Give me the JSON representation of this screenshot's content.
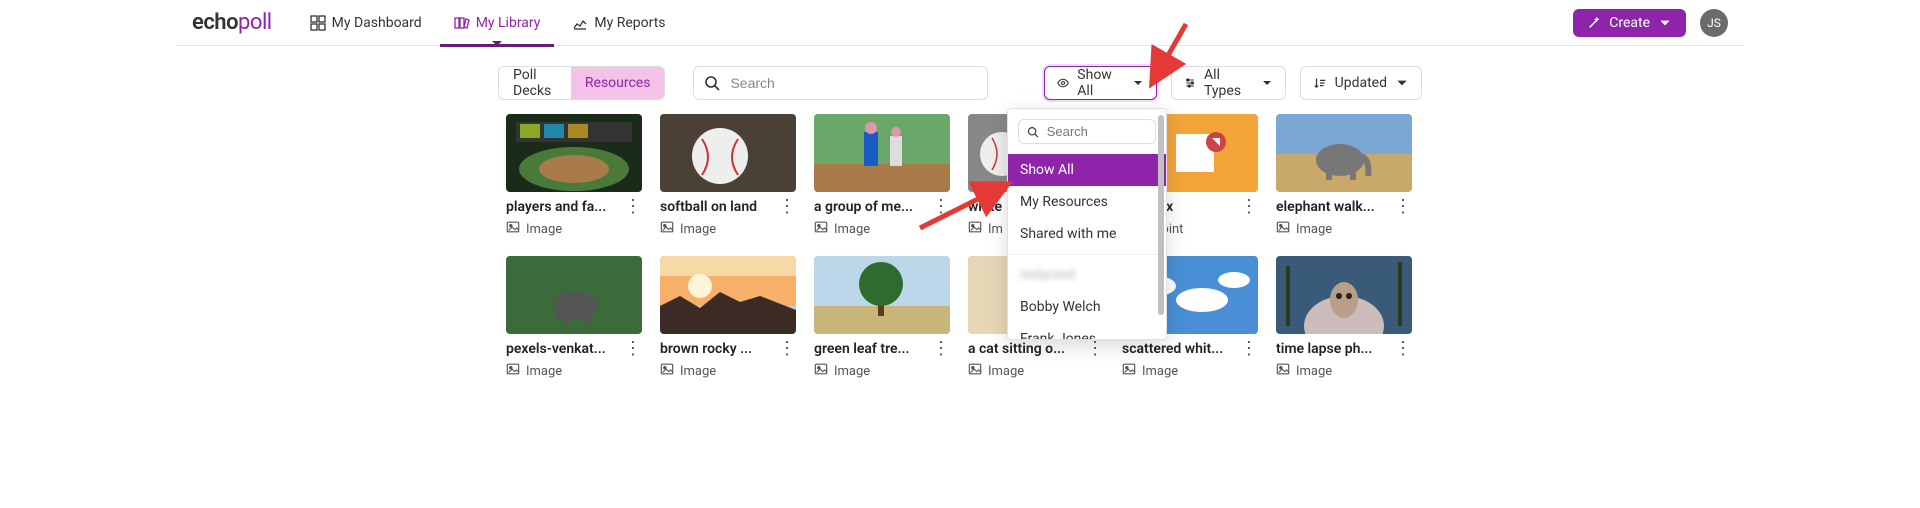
{
  "brand": {
    "part1": "echo",
    "part2": "poll"
  },
  "nav": {
    "items": [
      {
        "label": "My Dashboard"
      },
      {
        "label": "My Library"
      },
      {
        "label": "My Reports"
      }
    ]
  },
  "header": {
    "create_label": "Create",
    "avatar_initials": "JS"
  },
  "toolbar": {
    "segmented": {
      "poll_decks": "Poll Decks",
      "resources": "Resources"
    },
    "search_placeholder": "Search",
    "filter_visibility": {
      "label": "Show All"
    },
    "filter_type": {
      "label": "All Types"
    },
    "filter_sort": {
      "label": "Updated"
    }
  },
  "dropdown": {
    "search_placeholder": "Search",
    "items": [
      {
        "label": "Show All",
        "selected": true
      },
      {
        "label": "My Resources"
      },
      {
        "label": "Shared with me"
      },
      {
        "label": "redacted",
        "blurred": true
      },
      {
        "label": "Bobby Welch"
      },
      {
        "label": "Frank Jones",
        "truncated": true
      }
    ]
  },
  "cards": [
    {
      "title": "players and fa...",
      "type": "Image",
      "thumb": "stadium"
    },
    {
      "title": "softball on land",
      "type": "Image",
      "thumb": "baseball"
    },
    {
      "title": "a group of me...",
      "type": "Image",
      "thumb": "baseball-players"
    },
    {
      "title": "white",
      "type": "Im",
      "thumb": "baseballs"
    },
    {
      "title": "nts.pptx",
      "type": "erPoint",
      "thumb": "ppt"
    },
    {
      "title": "elephant walk...",
      "type": "Image",
      "thumb": "elephant-savanna"
    },
    {
      "title": "pexels-venkat...",
      "type": "Image",
      "thumb": "elephant-forest"
    },
    {
      "title": "brown rocky ...",
      "type": "Image",
      "thumb": "sunset-rocks"
    },
    {
      "title": "green leaf tre...",
      "type": "Image",
      "thumb": "tree"
    },
    {
      "title": "a cat sitting o...",
      "type": "Image",
      "thumb": "cat"
    },
    {
      "title": "scattered whit...",
      "type": "Image",
      "thumb": "clouds"
    },
    {
      "title": "time lapse ph...",
      "type": "Image",
      "thumb": "owl"
    }
  ]
}
